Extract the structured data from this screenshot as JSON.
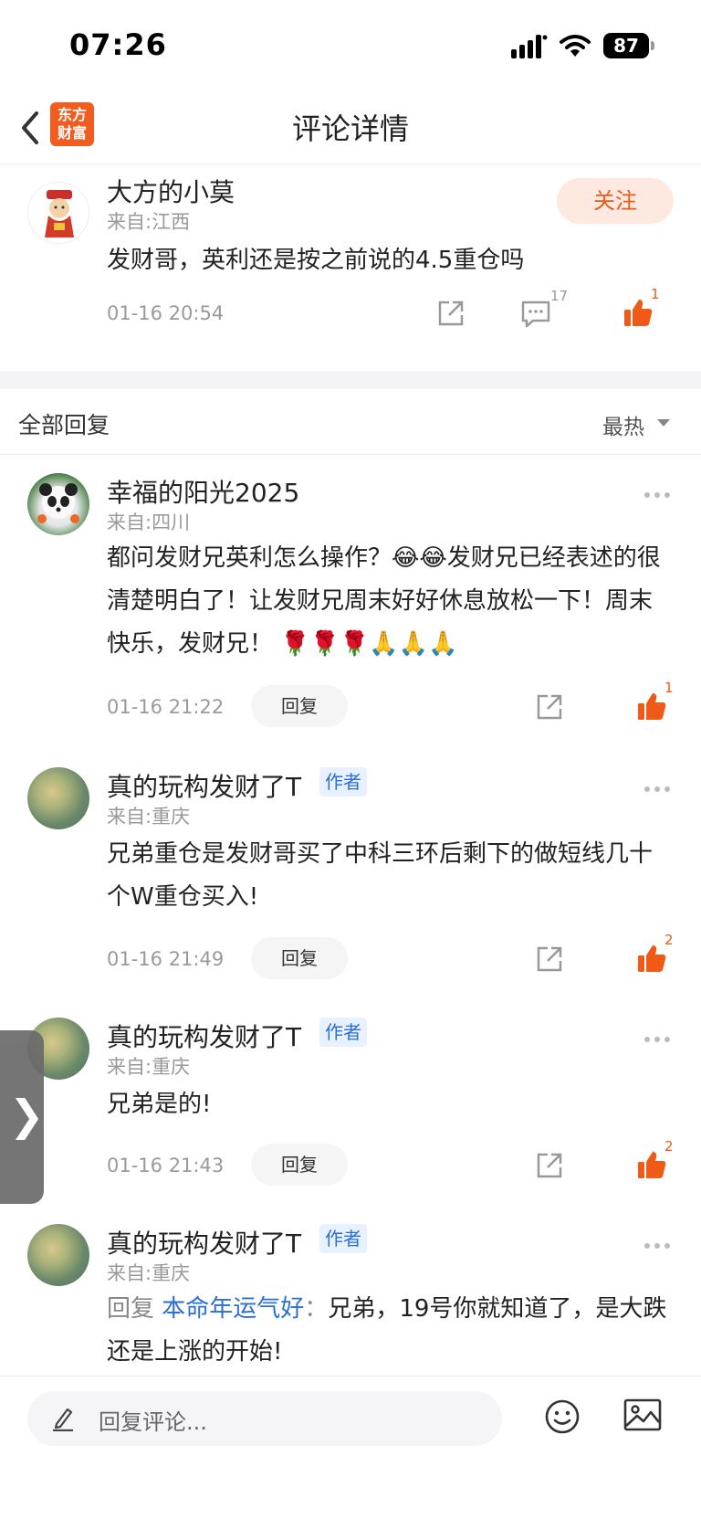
{
  "status_bar": {
    "time": "07:26",
    "battery": "87"
  },
  "nav": {
    "title": "评论详情",
    "logo_line1": "东方",
    "logo_line2": "财富"
  },
  "main_comment": {
    "username": "大方的小莫",
    "location": "来自:江西",
    "follow_label": "关注",
    "text": "发财哥，英利还是按之前说的4.5重仓吗",
    "time": "01-16 20:54",
    "comment_count": "17",
    "like_count": "1"
  },
  "replies_header": {
    "title": "全部回复",
    "sort": "最热"
  },
  "replies": [
    {
      "username": "幸福的阳光2025",
      "location": "来自:四川",
      "text": "都问发财兄英利怎么操作？😂😂发财兄已经表述的很清楚明白了！让发财兄周末好好休息放松一下！周末快乐，发财兄！ 🌹🌹🌹🙏🙏🙏",
      "time": "01-16 21:22",
      "reply_label": "回复",
      "like_count": "1"
    },
    {
      "username": "真的玩构发财了T",
      "author_tag": "作者",
      "location": "来自:重庆",
      "text": "兄弟重仓是发财哥买了中科三环后剩下的做短线几十个W重仓买入!",
      "time": "01-16 21:49",
      "reply_label": "回复",
      "like_count": "2"
    },
    {
      "username": "真的玩构发财了T",
      "author_tag": "作者",
      "location": "来自:重庆",
      "text": "兄弟是的!",
      "time": "01-16 21:43",
      "reply_label": "回复",
      "like_count": "2"
    },
    {
      "username": "真的玩构发财了T",
      "author_tag": "作者",
      "location": "来自:重庆",
      "reply_prefix": "回复",
      "reply_target": "本命年运气好",
      "reply_colon": "：",
      "text": "兄弟，19号你就知道了，是大跌还是上涨的开始!"
    }
  ],
  "side_handle": {
    "glyph": "❯"
  },
  "bottom_bar": {
    "placeholder": "回复评论..."
  },
  "colors": {
    "accent": "#e85a1c",
    "link": "#2b6fd6",
    "logo": "#f25c1e"
  }
}
